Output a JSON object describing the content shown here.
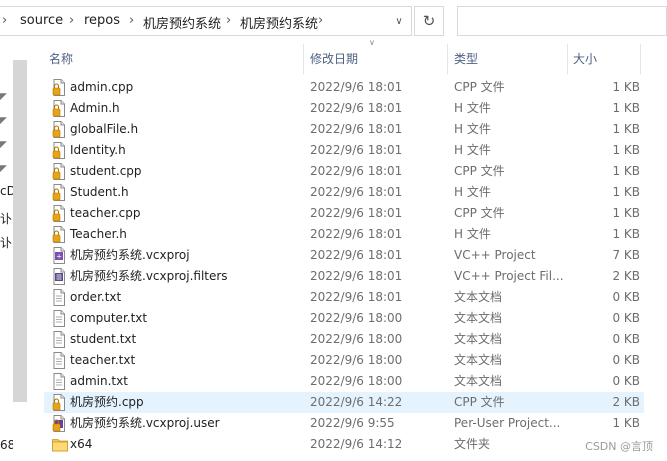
{
  "breadcrumb": {
    "items": [
      "source",
      "repos",
      "机房预约系统",
      "机房预约系统"
    ]
  },
  "columns": {
    "name": "名称",
    "date": "修改日期",
    "type": "类型",
    "size": "大小"
  },
  "nav_fragments": [
    "cD",
    "讣",
    "讣",
    "68"
  ],
  "files": [
    {
      "name": "admin.cpp",
      "date": "2022/9/6 18:01",
      "type": "CPP 文件",
      "size": "1 KB",
      "icon": "cpp-file-icon"
    },
    {
      "name": "Admin.h",
      "date": "2022/9/6 18:01",
      "type": "H 文件",
      "size": "1 KB",
      "icon": "h-file-icon"
    },
    {
      "name": "globalFile.h",
      "date": "2022/9/6 18:01",
      "type": "H 文件",
      "size": "1 KB",
      "icon": "h-file-icon"
    },
    {
      "name": "Identity.h",
      "date": "2022/9/6 18:01",
      "type": "H 文件",
      "size": "1 KB",
      "icon": "h-file-icon"
    },
    {
      "name": "student.cpp",
      "date": "2022/9/6 18:01",
      "type": "CPP 文件",
      "size": "1 KB",
      "icon": "cpp-file-icon"
    },
    {
      "name": "Student.h",
      "date": "2022/9/6 18:01",
      "type": "H 文件",
      "size": "1 KB",
      "icon": "h-file-icon"
    },
    {
      "name": "teacher.cpp",
      "date": "2022/9/6 18:01",
      "type": "CPP 文件",
      "size": "1 KB",
      "icon": "cpp-file-icon"
    },
    {
      "name": "Teacher.h",
      "date": "2022/9/6 18:01",
      "type": "H 文件",
      "size": "1 KB",
      "icon": "h-file-icon"
    },
    {
      "name": "机房预约系统.vcxproj",
      "date": "2022/9/6 18:01",
      "type": "VC++ Project",
      "size": "7 KB",
      "icon": "vcxproj-file-icon"
    },
    {
      "name": "机房预约系统.vcxproj.filters",
      "date": "2022/9/6 18:01",
      "type": "VC++ Project Fil...",
      "size": "2 KB",
      "icon": "filters-file-icon"
    },
    {
      "name": "order.txt",
      "date": "2022/9/6 18:01",
      "type": "文本文档",
      "size": "0 KB",
      "icon": "txt-file-icon"
    },
    {
      "name": "computer.txt",
      "date": "2022/9/6 18:00",
      "type": "文本文档",
      "size": "0 KB",
      "icon": "txt-file-icon"
    },
    {
      "name": "student.txt",
      "date": "2022/9/6 18:00",
      "type": "文本文档",
      "size": "0 KB",
      "icon": "txt-file-icon"
    },
    {
      "name": "teacher.txt",
      "date": "2022/9/6 18:00",
      "type": "文本文档",
      "size": "0 KB",
      "icon": "txt-file-icon"
    },
    {
      "name": "admin.txt",
      "date": "2022/9/6 18:00",
      "type": "文本文档",
      "size": "0 KB",
      "icon": "txt-file-icon"
    },
    {
      "name": "机房预约.cpp",
      "date": "2022/9/6 14:22",
      "type": "CPP 文件",
      "size": "2 KB",
      "icon": "cpp-file-icon",
      "selected": true
    },
    {
      "name": "机房预约系统.vcxproj.user",
      "date": "2022/9/6 9:55",
      "type": "Per-User Project...",
      "size": "1 KB",
      "icon": "user-file-icon"
    },
    {
      "name": "x64",
      "date": "2022/9/6 14:12",
      "type": "文件夹",
      "size": "",
      "icon": "folder-icon"
    }
  ],
  "watermark": "CSDN @言顶",
  "colors": {
    "selected_row": "#e5f3ff",
    "header_text": "#4d6082",
    "lock_badge": "#e8a317",
    "folder": "#f2c55c"
  }
}
